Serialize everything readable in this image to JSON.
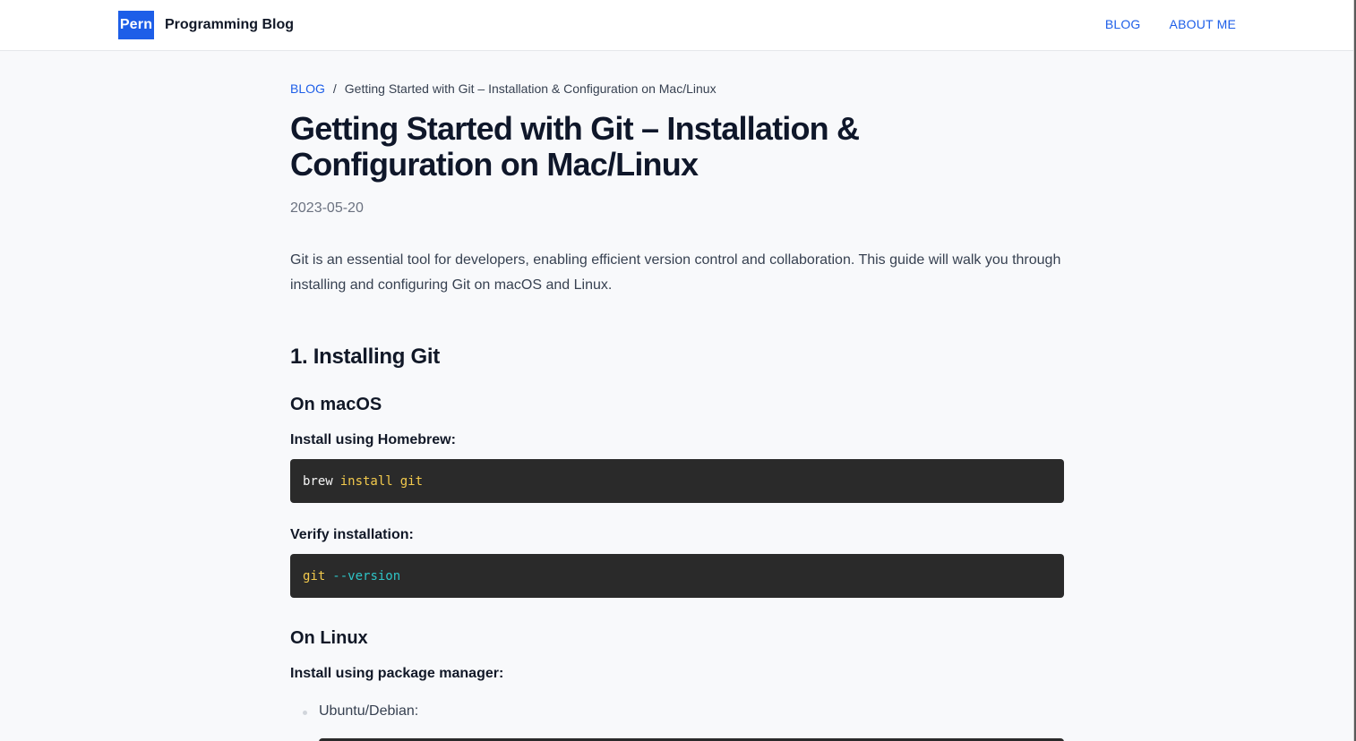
{
  "header": {
    "logo_text": "Pern",
    "site_title": "Programming Blog",
    "nav": [
      {
        "label": "BLOG"
      },
      {
        "label": "ABOUT ME"
      }
    ]
  },
  "breadcrumb": {
    "root": "BLOG",
    "separator": "/",
    "current": "Getting Started with Git – Installation & Configuration on Mac/Linux"
  },
  "post": {
    "title": "Getting Started with Git – Installation & Configuration on Mac/Linux",
    "date": "2023-05-20",
    "intro": "Git is an essential tool for developers, enabling efficient version control and collaboration. This guide will walk you through installing and configuring Git on macOS and Linux.",
    "section1_heading": "1. Installing Git",
    "macos": {
      "heading": "On macOS",
      "install_label": "Install using Homebrew:",
      "install_code": {
        "cmd": "brew",
        "arg1": "install",
        "arg2": "git"
      },
      "verify_label": "Verify installation:",
      "verify_code": {
        "cmd": "git",
        "flag": "--version"
      }
    },
    "linux": {
      "heading": "On Linux",
      "install_label": "Install using package manager:",
      "items": [
        "Ubuntu/Debian:"
      ]
    }
  },
  "colors": {
    "accent": "#1d5ee8",
    "code_bg": "#2a2a2a",
    "code_keyword": "#f2c94c",
    "code_flag": "#2ec4c6"
  }
}
